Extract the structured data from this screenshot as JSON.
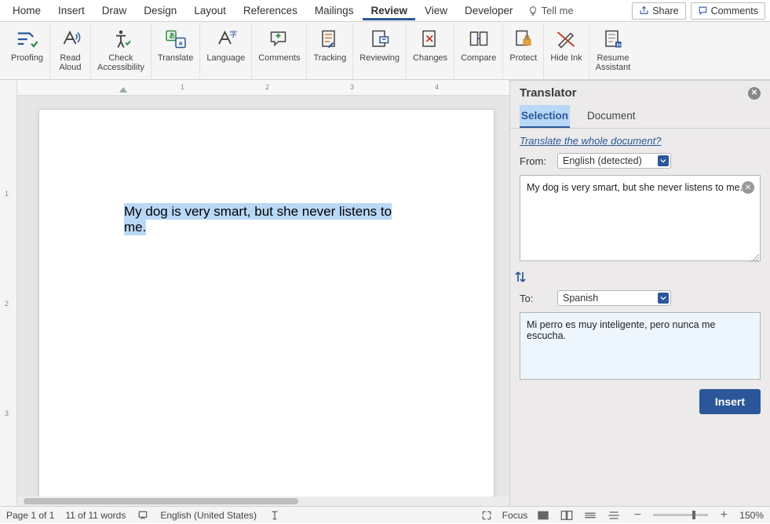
{
  "menu": [
    "Home",
    "Insert",
    "Draw",
    "Design",
    "Layout",
    "References",
    "Mailings",
    "Review",
    "View",
    "Developer"
  ],
  "menu_active": 7,
  "tellme": "Tell me",
  "share": "Share",
  "comments": "Comments",
  "ribbon": [
    {
      "label": "Proofing"
    },
    {
      "label": "Read\nAloud"
    },
    {
      "label": "Check\nAccessibility"
    },
    {
      "label": "Translate"
    },
    {
      "label": "Language"
    },
    {
      "label": "Comments"
    },
    {
      "label": "Tracking"
    },
    {
      "label": "Reviewing"
    },
    {
      "label": "Changes"
    },
    {
      "label": "Compare"
    },
    {
      "label": "Protect"
    },
    {
      "label": "Hide Ink"
    },
    {
      "label": "Resume\nAssistant"
    }
  ],
  "doc_text": "My dog is very smart, but she never listens to me.",
  "ruler_h": [
    "1",
    "2",
    "3",
    "4"
  ],
  "ruler_v": [
    "1",
    "2",
    "3"
  ],
  "translator": {
    "title": "Translator",
    "tabs": [
      "Selection",
      "Document"
    ],
    "tab_active": 0,
    "whole_link": "Translate the whole document?",
    "from_label": "From:",
    "from_lang": "English (detected)",
    "src_text": "My dog is very smart, but she never listens to me.",
    "to_label": "To:",
    "to_lang": "Spanish",
    "dst_text": "Mi perro es muy inteligente, pero nunca me escucha.",
    "insert": "Insert"
  },
  "status": {
    "page": "Page 1 of 1",
    "words": "11 of 11 words",
    "lang": "English (United States)",
    "focus": "Focus",
    "zoom": "150%"
  }
}
